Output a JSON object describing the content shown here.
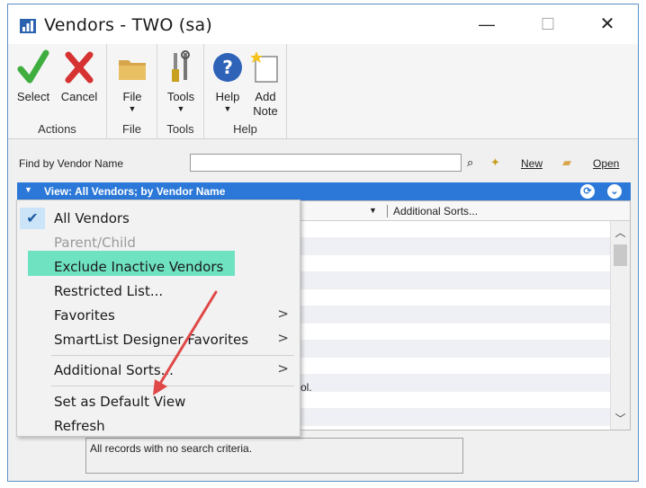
{
  "window": {
    "title": "Vendors  -  TWO (sa)",
    "controls": {
      "minimize": "—",
      "maximize": "☐",
      "close": "✕"
    }
  },
  "ribbon": {
    "groups": {
      "actions": {
        "label": "Actions",
        "select": "Select",
        "cancel": "Cancel"
      },
      "file": {
        "label": "File",
        "file": "File"
      },
      "tools": {
        "label": "Tools",
        "tools": "Tools"
      },
      "help": {
        "label": "Help",
        "help": "Help",
        "add_note_1": "Add",
        "add_note_2": "Note"
      }
    },
    "dropdown_glyph": "▼"
  },
  "find": {
    "label": "Find by Vendor Name",
    "value": "",
    "new_label": "New",
    "open_label": "Open"
  },
  "view": {
    "label": "View: All Vendors; by Vendor Name"
  },
  "grid": {
    "additional_sorts": "Additional Sorts...",
    "partial_text": "ol."
  },
  "criteria": {
    "text": "All records with no search criteria."
  },
  "menu": {
    "items": [
      {
        "label": "All Vendors"
      },
      {
        "label": "Parent/Child"
      },
      {
        "label": "Exclude Inactive Vendors"
      },
      {
        "label": "Restricted List..."
      },
      {
        "label": "Favorites"
      },
      {
        "label": "SmartList Designer Favorites"
      },
      {
        "label": "Additional Sorts..."
      },
      {
        "label": "Set as Default View"
      },
      {
        "label": "Refresh"
      }
    ],
    "check": "✔",
    "submenu_arrow": ">"
  },
  "colors": {
    "view_bar": "#2b78d8",
    "highlight": "#6fe2c2",
    "annotation_arrow": "#e04848"
  }
}
